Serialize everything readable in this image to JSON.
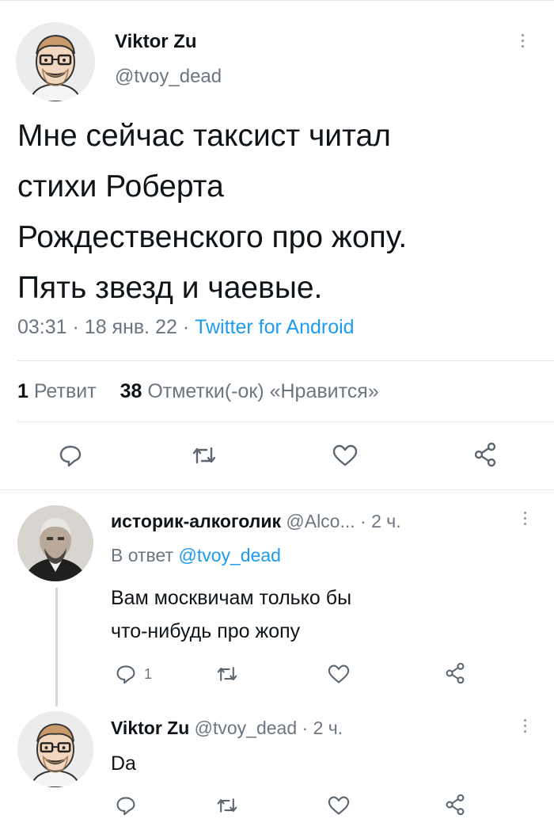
{
  "main_tweet": {
    "author_name": "Viktor Zu",
    "author_handle": "@tvoy_dead",
    "text_lines": [
      "Мне сейчас таксист читал",
      "стихи Роберта",
      "Рождественского про жопу.",
      "Пять звезд и чаевые."
    ],
    "time": "03:31",
    "date": "18 янв. 22",
    "separator": "·",
    "source": "Twitter for Android",
    "retweets_count": "1",
    "retweets_label": "Ретвит",
    "likes_count": "38",
    "likes_label": "Отметки(-ок) «Нравится»"
  },
  "reply_1": {
    "author_name": "историк-алкоголик",
    "author_handle": "@Alco...",
    "time_ago": "· 2 ч.",
    "reply_to_prefix": "В ответ",
    "reply_to_handle": "@tvoy_dead",
    "text_lines": [
      "Вам москвичам только бы",
      "что-нибудь про жопу"
    ],
    "reply_count": "1"
  },
  "reply_2": {
    "author_name": "Viktor Zu",
    "author_handle": "@tvoy_dead",
    "time_ago": "· 2 ч.",
    "text": "Da"
  },
  "icons": {
    "reply": "speech-bubble-icon",
    "retweet": "retweet-arrows-icon",
    "like": "heart-icon",
    "share": "share-nodes-icon",
    "more": "vertical-dots-icon"
  },
  "colors": {
    "link": "#1d9bf0",
    "secondary_text": "#6b7680",
    "divider": "#e4e8ec"
  }
}
